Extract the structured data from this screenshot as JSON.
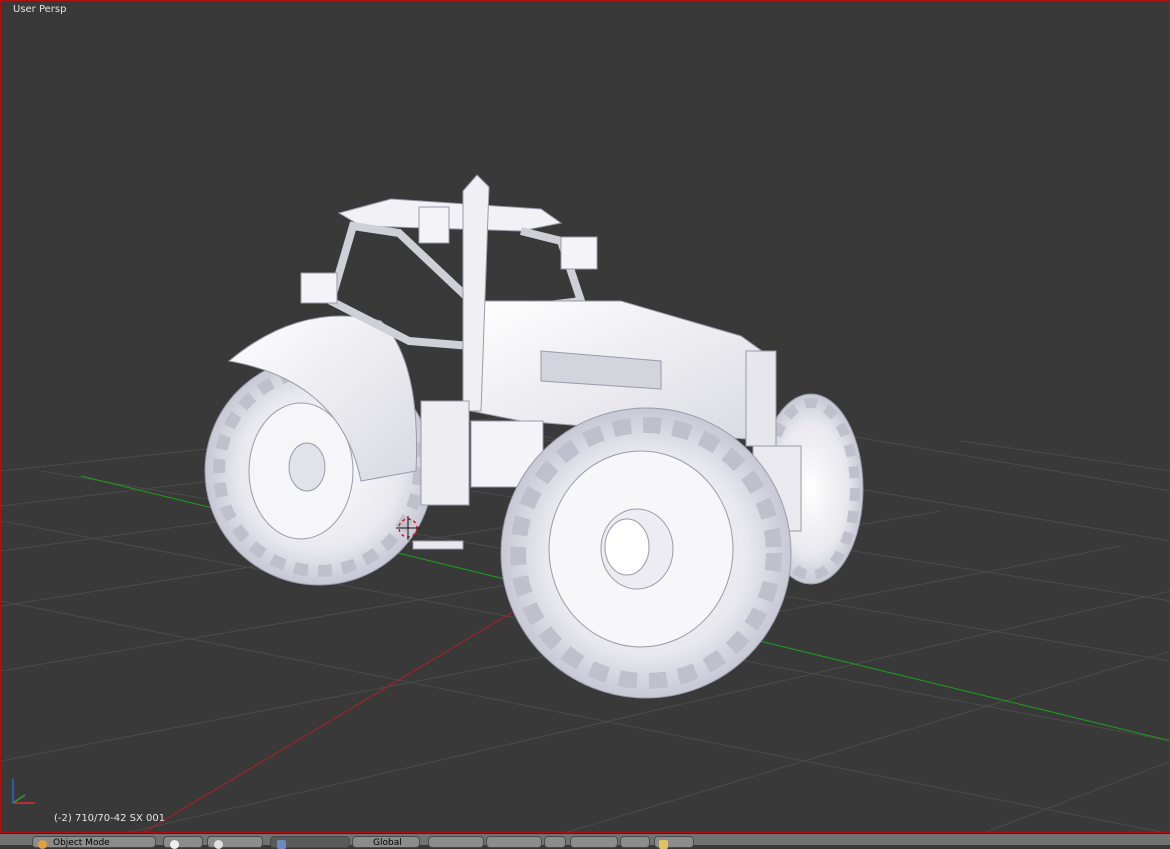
{
  "viewport": {
    "view_name": "User Persp",
    "object_name": "(-2) 710/70-42 SX 001"
  },
  "header": {
    "mode_label": "Object Mode",
    "shading_label": "Global"
  },
  "colors": {
    "background": "#393939",
    "grid": "#4b4b4b",
    "x_axis": "#b02020",
    "y_axis": "#1f9a1f",
    "model": "#f3f3f8",
    "active_border": "#b01010"
  },
  "icons": [
    "cursor-3d-icon",
    "axis-gizmo-icon",
    "mode-menu-icon",
    "sphere-shading-icon",
    "pivot-icon",
    "transform-manipulator-icon",
    "layer-buttons",
    "render-icon"
  ]
}
